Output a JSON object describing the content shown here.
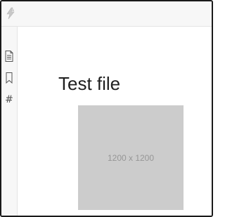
{
  "toolbar": {
    "logo_icon": "lightning-logo-icon"
  },
  "sidebar": {
    "items": [
      {
        "icon": "document-icon",
        "glyph": ""
      },
      {
        "icon": "bookmark-icon",
        "glyph": ""
      },
      {
        "icon": "hash-icon",
        "glyph": "#"
      }
    ]
  },
  "main": {
    "title": "Test file",
    "image_placeholder": "1200 x 1200"
  },
  "colors": {
    "toolbar_bg": "#f7f7f7",
    "placeholder_bg": "#cccccc",
    "placeholder_text": "#969696"
  }
}
